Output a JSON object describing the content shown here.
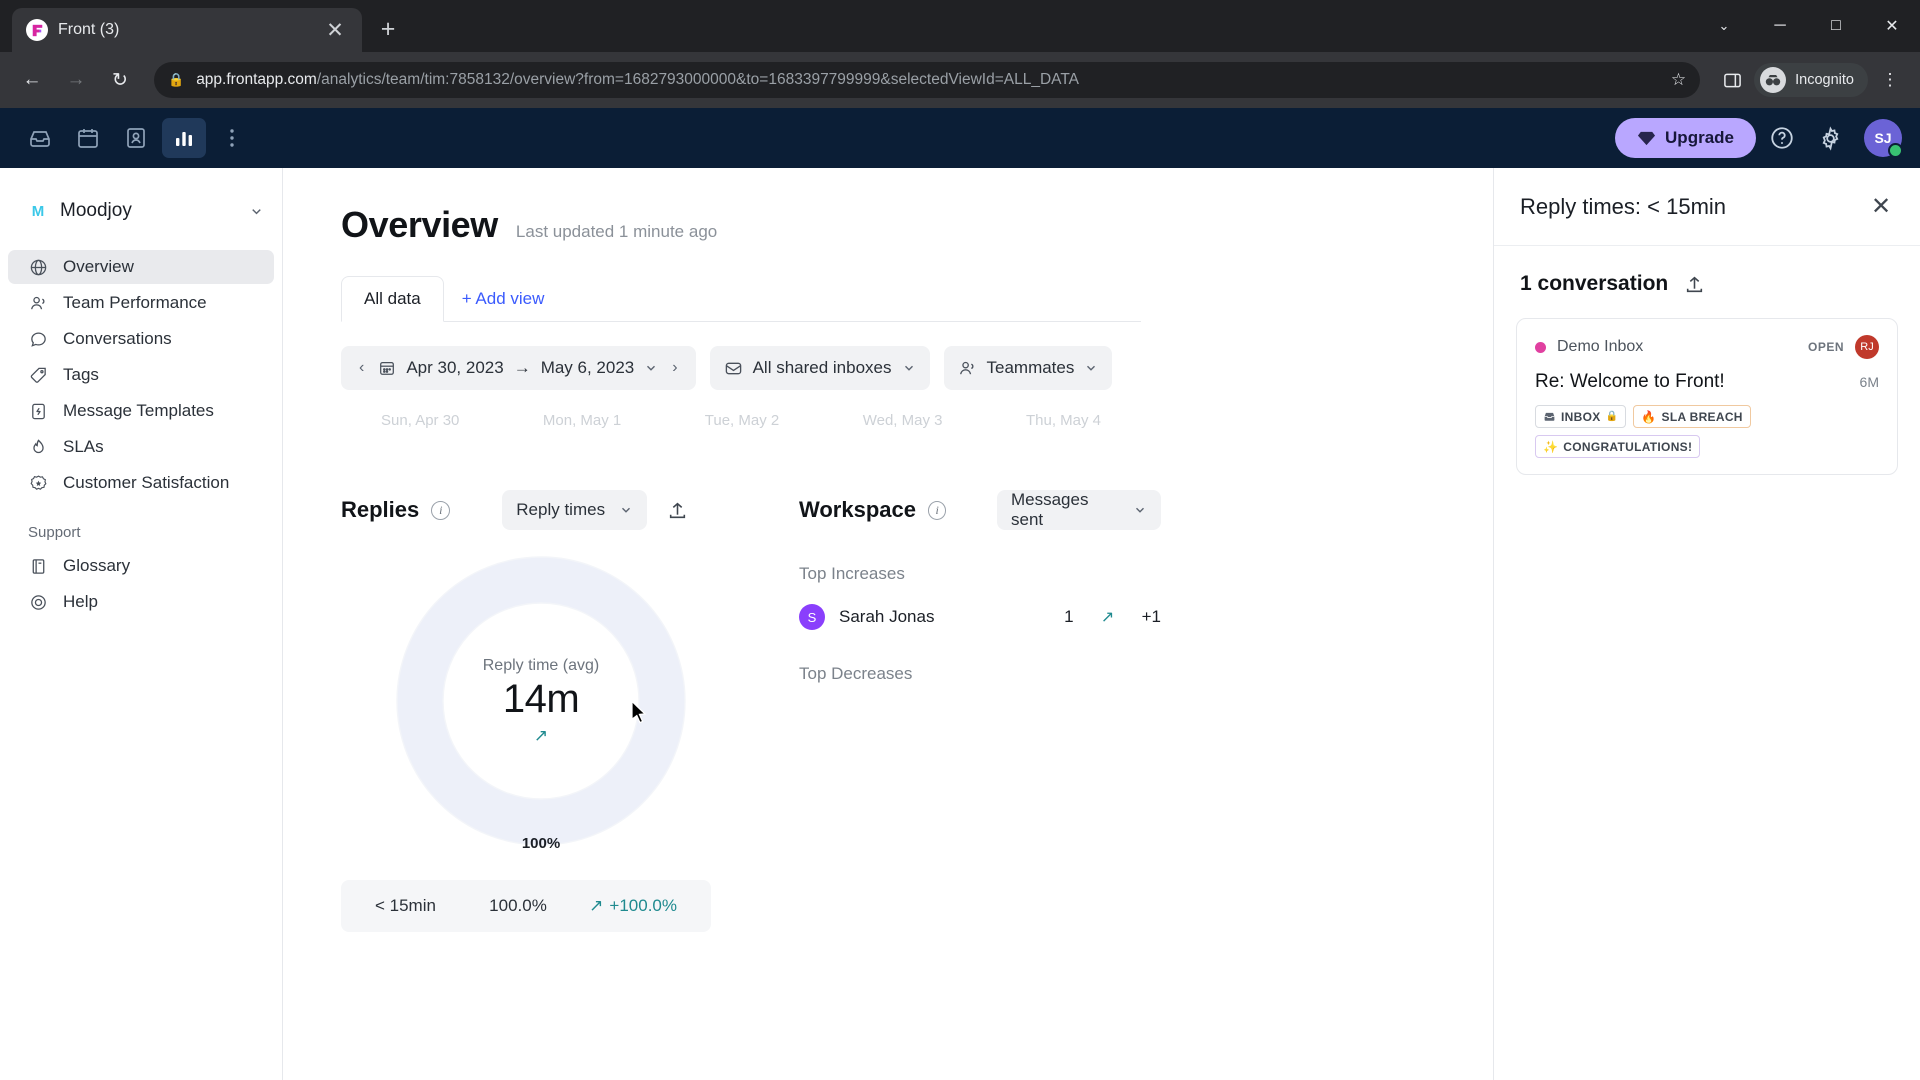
{
  "browser": {
    "tab_title": "Front (3)",
    "tab_favicon": "front-logo-icon",
    "url_domain": "app.frontapp.com",
    "url_path": "/analytics/team/tim:7858132/overview?from=1682793000000&to=1683397799999&selectedViewId=ALL_DATA",
    "profile_label": "Incognito",
    "new_tab_label": "+",
    "close_tab_label": "✕",
    "back_label": "←",
    "forward_label": "→",
    "reload_label": "↻",
    "window_minimize": "─",
    "window_maximize": "□",
    "window_close": "✕",
    "window_chevron": "⌄"
  },
  "topbar": {
    "upgrade_label": "Upgrade",
    "icons": [
      "inbox-icon",
      "calendar-icon",
      "contacts-icon",
      "analytics-icon",
      "more-icon"
    ],
    "avatar_initials": "SJ"
  },
  "sidebar": {
    "workspace_initial": "M",
    "workspace_name": "Moodjoy",
    "items": [
      {
        "label": "Overview",
        "icon": "globe-icon",
        "active": true
      },
      {
        "label": "Team Performance",
        "icon": "people-icon",
        "active": false
      },
      {
        "label": "Conversations",
        "icon": "chat-bubble-icon",
        "active": false
      },
      {
        "label": "Tags",
        "icon": "tag-icon",
        "active": false
      },
      {
        "label": "Message Templates",
        "icon": "template-icon",
        "active": false
      },
      {
        "label": "SLAs",
        "icon": "flame-icon",
        "active": false
      },
      {
        "label": "Customer Satisfaction",
        "icon": "star-badge-icon",
        "active": false
      }
    ],
    "support_heading": "Support",
    "support_items": [
      {
        "label": "Glossary",
        "icon": "book-icon"
      },
      {
        "label": "Help",
        "icon": "lifebuoy-icon"
      }
    ]
  },
  "main": {
    "page_title": "Overview",
    "last_updated": "Last updated 1 minute ago",
    "tab_all_data": "All data",
    "add_view": "+ Add view",
    "filters": {
      "date_from": "Apr 30, 2023",
      "date_to": "May 6, 2023",
      "date_arrow": "→",
      "prev_label": "‹",
      "next_label": "›",
      "inbox_filter": "All shared inboxes",
      "teammates_filter": "Teammates"
    },
    "axis_labels": [
      "Sun, Apr 30",
      "Mon, May 1",
      "Tue, May 2",
      "Wed, May 3",
      "Thu, May 4"
    ],
    "replies": {
      "title": "Replies",
      "metric_select": "Reply times",
      "center_label": "Reply time (avg)",
      "center_value": "14m",
      "center_trend": "↗",
      "ring_pct_label": "100%",
      "legend": {
        "name": "< 15min",
        "percent": "100.0%",
        "delta": "+100.0%",
        "delta_arrow": "↗"
      }
    },
    "workspace": {
      "title": "Workspace",
      "metric_select": "Messages sent",
      "top_increases_label": "Top Increases",
      "top_decreases_label": "Top Decreases",
      "increases": [
        {
          "avatar_initial": "S",
          "name": "Sarah Jonas",
          "count": "1",
          "arrow": "↗",
          "delta": "+1"
        }
      ]
    }
  },
  "right_panel": {
    "title": "Reply times: < 15min",
    "close_label": "✕",
    "count_label": "1 conversation",
    "export_icon": "upload-icon",
    "conversation": {
      "inbox": "Demo Inbox",
      "status": "OPEN",
      "assignee_initials": "RJ",
      "subject": "Re: Welcome to Front!",
      "time": "6M",
      "tags": [
        {
          "label": "INBOX",
          "icon": "inbox-tag-icon",
          "lock": "🔒",
          "style": "plain"
        },
        {
          "label": "SLA BREACH",
          "icon": "🔥",
          "style": "orange"
        },
        {
          "label": "CONGRATULATIONS!",
          "icon": "✨",
          "style": "purple"
        }
      ]
    }
  },
  "chart_data": {
    "type": "pie",
    "title": "Reply times",
    "categories": [
      "< 15min"
    ],
    "values": [
      100.0
    ],
    "value_unit": "%",
    "center_metric": "Reply time (avg)",
    "center_value": "14m",
    "legend_position": "bottom",
    "annotations": [
      "100%"
    ],
    "series": [
      {
        "name": "< 15min",
        "percent": 100.0,
        "delta_percent": 100.0,
        "color": "#edf0f9"
      }
    ]
  },
  "colors": {
    "accent": "#3b5bfd",
    "upgrade": "#b9a7ff",
    "topbar": "#0b1e36",
    "donut": "#edf0f9",
    "teal": "#1f8a8f",
    "pink": "#e040a0"
  }
}
